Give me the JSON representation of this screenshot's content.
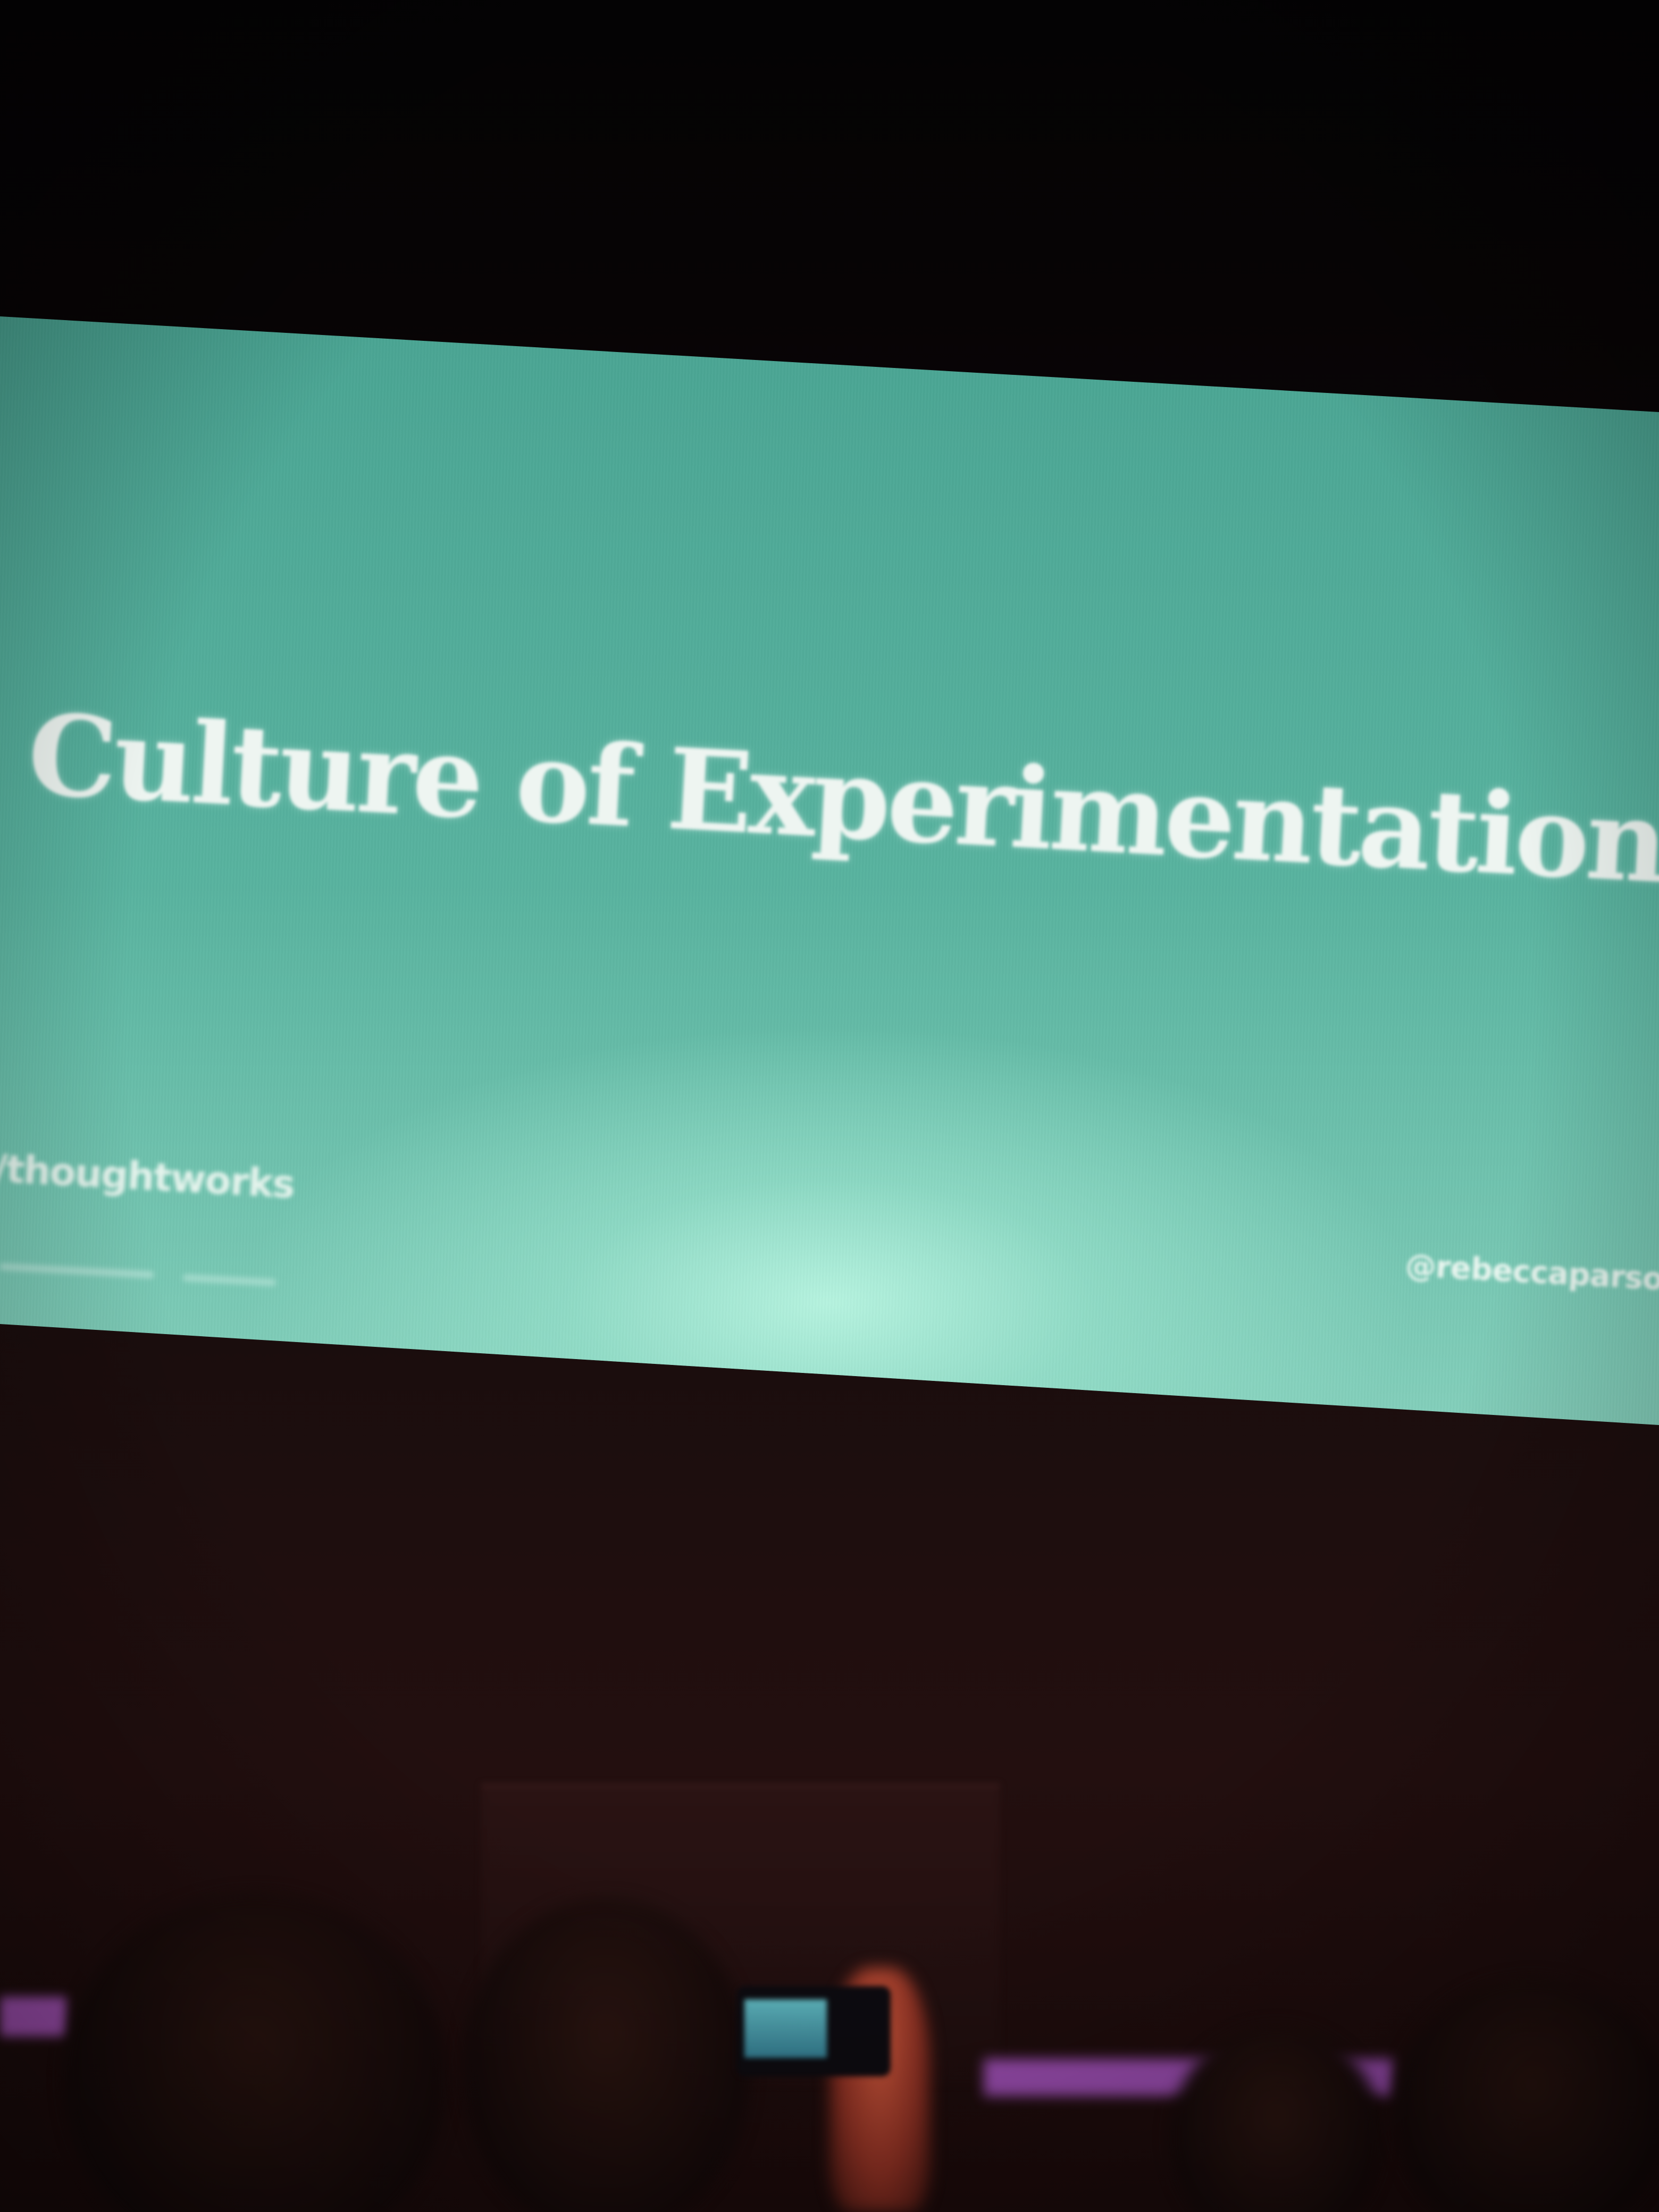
{
  "slide": {
    "title": "Culture of Experimentation",
    "logo_text": "/thoughtworks",
    "handle": "@rebeccaparsor"
  },
  "colors": {
    "screen_teal": "#4aa593",
    "screen_highlight": "#b9f5e1",
    "title_text": "#eef5f1",
    "room_dark": "#050304",
    "stage_purple_light": "#b45ad2"
  }
}
